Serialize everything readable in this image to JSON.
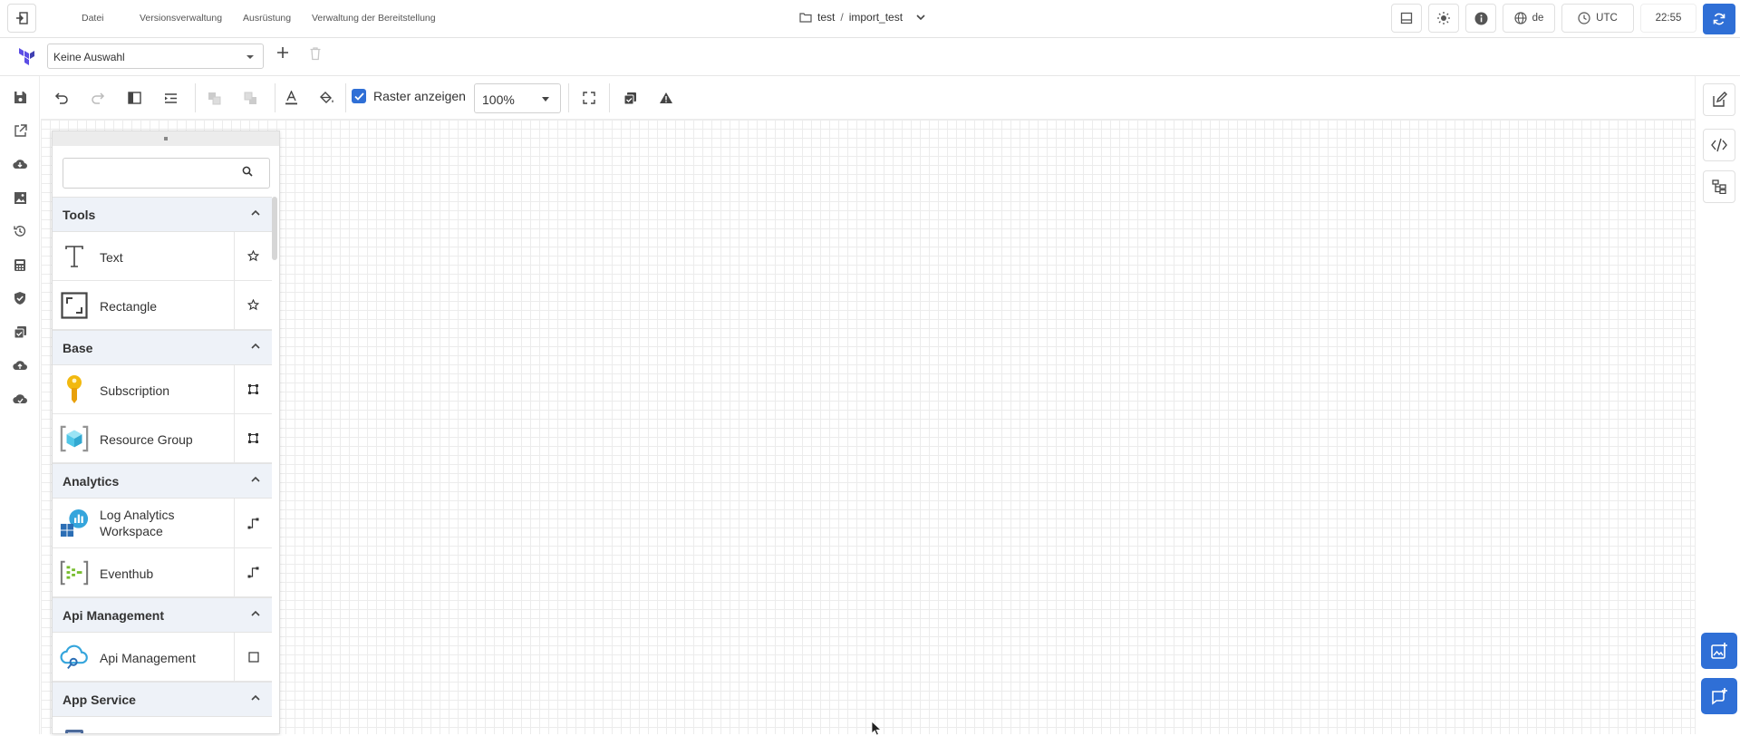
{
  "topbar": {
    "menu": [
      "Datei",
      "Versionsverwaltung",
      "Ausrüstung",
      "Verwaltung der Bereitstellung"
    ],
    "project_folder": "test",
    "project_separator": "/",
    "project_file": "import_test",
    "language": "de",
    "timezone": "UTC",
    "time": "22:55"
  },
  "secondbar": {
    "selection_value": "Keine Auswahl"
  },
  "toolbar": {
    "show_grid_label": "Raster anzeigen",
    "show_grid_checked": true,
    "zoom": "100%"
  },
  "palette": {
    "search_placeholder": "",
    "categories": [
      {
        "label": "Tools",
        "items": [
          {
            "label": "Text",
            "icon": "text-tool-icon",
            "action": "star-icon"
          },
          {
            "label": "Rectangle",
            "icon": "rectangle-tool-icon",
            "action": "star-icon"
          }
        ]
      },
      {
        "label": "Base",
        "items": [
          {
            "label": "Subscription",
            "icon": "key-icon",
            "action": "container-icon"
          },
          {
            "label": "Resource Group",
            "icon": "resource-group-icon",
            "action": "container-icon"
          }
        ]
      },
      {
        "label": "Analytics",
        "items": [
          {
            "label": "Log Analytics Workspace",
            "icon": "log-analytics-icon",
            "action": "connector-icon"
          },
          {
            "label": "Eventhub",
            "icon": "eventhub-icon",
            "action": "connector-icon"
          }
        ]
      },
      {
        "label": "Api Management",
        "items": [
          {
            "label": "Api Management",
            "icon": "api-management-icon",
            "action": "square-icon"
          }
        ]
      },
      {
        "label": "App Service",
        "items": []
      }
    ]
  },
  "colors": {
    "accent": "#2f6fd6",
    "category_bg": "#eef2f8",
    "grid": "#ececec"
  }
}
